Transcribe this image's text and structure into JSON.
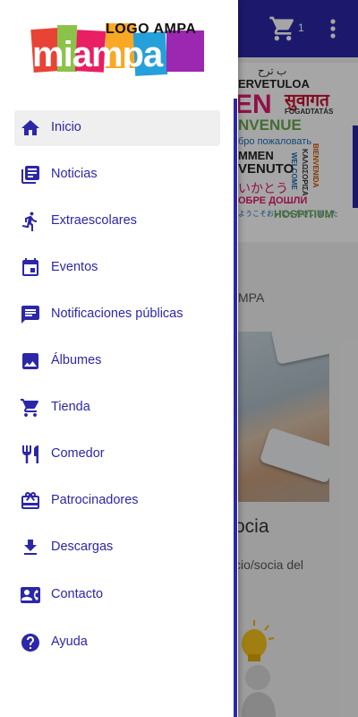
{
  "drawer": {
    "logo_text": "LOGO AMPA",
    "brand_letters": [
      "m",
      "i",
      "a",
      "m",
      "p",
      "a"
    ],
    "items": [
      {
        "label": "Inicio",
        "icon": "home-icon",
        "active": true
      },
      {
        "label": "Noticias",
        "icon": "newspaper-icon",
        "active": false
      },
      {
        "label": "Extraescolares",
        "icon": "running-person-icon",
        "active": false
      },
      {
        "label": "Eventos",
        "icon": "calendar-icon",
        "active": false
      },
      {
        "label": "Notificaciones públicas",
        "icon": "chat-message-icon",
        "active": false
      },
      {
        "label": "Álbumes",
        "icon": "image-icon",
        "active": false
      },
      {
        "label": "Tienda",
        "icon": "shopping-cart-icon",
        "active": false
      },
      {
        "label": "Comedor",
        "icon": "fork-knife-icon",
        "active": false
      },
      {
        "label": "Patrocinadores",
        "icon": "gift-card-icon",
        "active": false
      },
      {
        "label": "Descargas",
        "icon": "download-icon",
        "active": false
      },
      {
        "label": "Contacto",
        "icon": "contact-card-icon",
        "active": false
      },
      {
        "label": "Ayuda",
        "icon": "help-circle-icon",
        "active": false
      }
    ]
  },
  "appbar": {
    "cart_count": "1"
  },
  "background": {
    "welcome_words": [
      "ب ترح",
      "ERVETULOA",
      "EN",
      "सुवागत",
      "FOGADTATÁS",
      "NVENUE",
      "бро пожаловать",
      "MMEN",
      "WELCOME",
      "KAΛΩΣOPIΣA",
      "VENUTO",
      "BIENVENIDA",
      "いかとう",
      "ОБРЕ ДОШЛИ",
      "ようこそおいでくださいました",
      "HOSPITIUM"
    ],
    "section_text": "MPA",
    "post_title": "ocia",
    "post_excerpt": "cio/socia del"
  },
  "colors": {
    "accent": "#2c27a8",
    "appbar": "#2c27a8",
    "active_item_bg": "#efefef"
  }
}
